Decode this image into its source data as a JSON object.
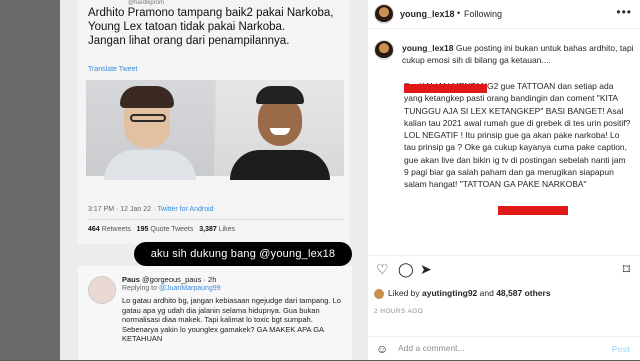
{
  "post_image": {
    "tweet_handle": "@hardikprom",
    "tweet_text": "Ardhito Pramono tampang baik2 pakai Narkoba, Young Lex tatoan tidak pakai Narkoba.\nJangan lihat orang dari penampilannya.",
    "translate": "Translate Tweet",
    "meta_time": "3:17 PM · 12 Jan 22 · ",
    "meta_source": "Twitter for Android",
    "retweets_count": "464",
    "retweets_label": "Retweets",
    "quotes_count": "195",
    "quotes_label": "Quote Tweets",
    "likes_count": "3,387",
    "likes_label": "Likes",
    "overlay_text": "aku sih dukung bang @young_lex18",
    "reply_name": "Paus",
    "reply_handle": "@gorgeous_paus · 2h",
    "reply_to_label": "Replying to",
    "reply_to_handle": "@JuanMarpaung99",
    "reply_text": "Lo gatau ardhito bg, jangan kebiasaan ngejudge dari tampang. Lo gatau apa yg udah dia jalanin selama hidupnya. Gua bukan normalisasi diaa makek. Tapi kalimat lo toxic bgt sumpah. Sebenarya yakin lo younglex gamakek? GA MAKEK APA GA KETAHUAN"
  },
  "header": {
    "username": "young_lex18",
    "dot": "•",
    "following": "Following",
    "more": "•••"
  },
  "caption": {
    "username": "young_lex18",
    "first_line": "Gue posting ini bukan untuk bahas ardhito, tapi cukup emosi sih di bilang ga ketauan....",
    "body": "E... KALIAN MENTANG2 gue TATTOAN dan setiap ada yang ketangkep pasti orang bandingin dan coment \"KITA TUNGGU AJA SI LEX KETANGKEP\" BASI BANGET! Asal kalian tau 2021 awal rumah gue di grebek di tes urin positif? LOL NEGATIF ! Itu prinsip gue ga akan pake narkoba! Lo tau prinsip ga ? Oke ga cukup kayanya cuma pake caption, gue akan live dan bikin ig tv di postingan sebelah nanti jam 9 pagi biar ga salah paham dan ga merugikan siapapun salam hangat! \"TATTOAN GA PAKE NARKOBA\""
  },
  "likes": {
    "prefix": "Liked by ",
    "user": "ayutingting92",
    "and": " and ",
    "others": "48,587 others"
  },
  "time": "2 HOURS AGO",
  "comment": {
    "placeholder": "Add a comment...",
    "post_label": "Post"
  },
  "colors": {
    "redaction": "#e01818",
    "link_blue": "#3a8dde",
    "post_button": "#b2dffc"
  }
}
